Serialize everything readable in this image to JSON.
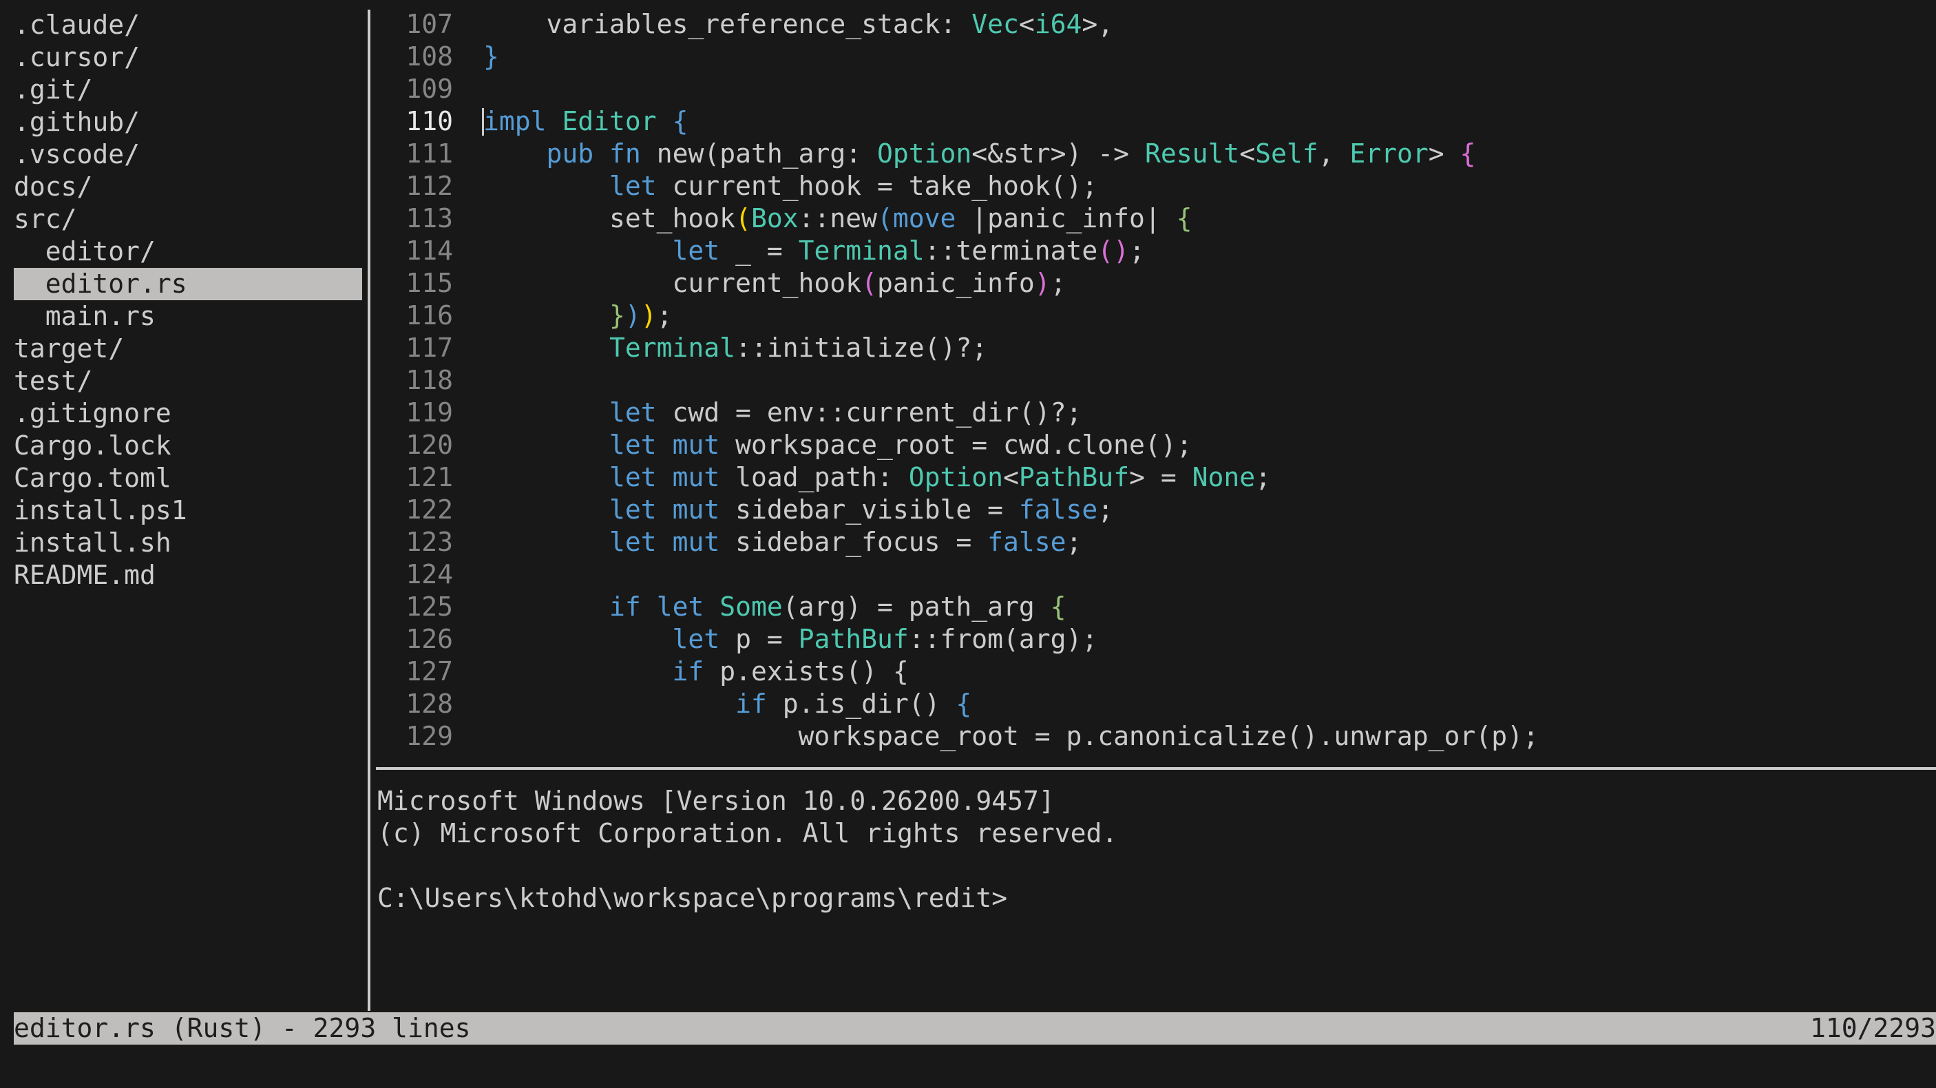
{
  "sidebar": {
    "items": [
      {
        "label": ".claude/",
        "indent": 0
      },
      {
        "label": ".cursor/",
        "indent": 0
      },
      {
        "label": ".git/",
        "indent": 0
      },
      {
        "label": ".github/",
        "indent": 0
      },
      {
        "label": ".vscode/",
        "indent": 0
      },
      {
        "label": "docs/",
        "indent": 0
      },
      {
        "label": "src/",
        "indent": 0
      },
      {
        "label": "editor/",
        "indent": 1
      },
      {
        "label": "editor.rs",
        "indent": 1,
        "selected": true
      },
      {
        "label": "main.rs",
        "indent": 1
      },
      {
        "label": "target/",
        "indent": 0
      },
      {
        "label": "test/",
        "indent": 0
      },
      {
        "label": ".gitignore",
        "indent": 0
      },
      {
        "label": "Cargo.lock",
        "indent": 0
      },
      {
        "label": "Cargo.toml",
        "indent": 0
      },
      {
        "label": "install.ps1",
        "indent": 0
      },
      {
        "label": "install.sh",
        "indent": 0
      },
      {
        "label": "README.md",
        "indent": 0
      }
    ]
  },
  "editor": {
    "current_line": 110,
    "lines": [
      {
        "n": "107",
        "tokens": [
          [
            "pl",
            "    variables_reference_stack: "
          ],
          [
            "ty",
            "Vec"
          ],
          [
            "pl",
            "<"
          ],
          [
            "ty",
            "i64"
          ],
          [
            "pl",
            ">,"
          ]
        ]
      },
      {
        "n": "108",
        "tokens": [
          [
            "b1",
            "}"
          ]
        ]
      },
      {
        "n": "109",
        "tokens": []
      },
      {
        "n": "110",
        "tokens": [
          [
            "kw",
            "impl"
          ],
          [
            "pl",
            " "
          ],
          [
            "ty",
            "Editor"
          ],
          [
            "pl",
            " "
          ],
          [
            "b1",
            "{"
          ]
        ]
      },
      {
        "n": "111",
        "tokens": [
          [
            "pl",
            "    "
          ],
          [
            "kw",
            "pub"
          ],
          [
            "pl",
            " "
          ],
          [
            "kw",
            "fn"
          ],
          [
            "pl",
            " new(path_arg: "
          ],
          [
            "ty",
            "Option"
          ],
          [
            "pl",
            "<&str>) -> "
          ],
          [
            "ty",
            "Result"
          ],
          [
            "pl",
            "<"
          ],
          [
            "ty",
            "Self"
          ],
          [
            "pl",
            ", "
          ],
          [
            "ty",
            "Error"
          ],
          [
            "pl",
            "> "
          ],
          [
            "b2",
            "{"
          ]
        ]
      },
      {
        "n": "112",
        "tokens": [
          [
            "pl",
            "        "
          ],
          [
            "kw",
            "let"
          ],
          [
            "pl",
            " current_hook = take_hook();"
          ]
        ]
      },
      {
        "n": "113",
        "tokens": [
          [
            "pl",
            "        set_hook"
          ],
          [
            "b3",
            "("
          ],
          [
            "ty",
            "Box"
          ],
          [
            "pl",
            "::new"
          ],
          [
            "b1",
            "("
          ],
          [
            "kw",
            "move"
          ],
          [
            "pl",
            " |panic_info| "
          ],
          [
            "bg",
            "{"
          ]
        ]
      },
      {
        "n": "114",
        "tokens": [
          [
            "pl",
            "            "
          ],
          [
            "kw",
            "let"
          ],
          [
            "pl",
            " _ = "
          ],
          [
            "ty",
            "Terminal"
          ],
          [
            "pl",
            "::terminate"
          ],
          [
            "b2",
            "()"
          ],
          [
            "pl",
            ";"
          ]
        ]
      },
      {
        "n": "115",
        "tokens": [
          [
            "pl",
            "            current_hook"
          ],
          [
            "b2",
            "("
          ],
          [
            "pl",
            "panic_info"
          ],
          [
            "b2",
            ")"
          ],
          [
            "pl",
            ";"
          ]
        ]
      },
      {
        "n": "116",
        "tokens": [
          [
            "pl",
            "        "
          ],
          [
            "bg",
            "}"
          ],
          [
            "b1",
            ")"
          ],
          [
            "b3",
            ")"
          ],
          [
            "pl",
            ";"
          ]
        ]
      },
      {
        "n": "117",
        "tokens": [
          [
            "pl",
            "        "
          ],
          [
            "ty",
            "Terminal"
          ],
          [
            "pl",
            "::initialize()?;"
          ]
        ]
      },
      {
        "n": "118",
        "tokens": []
      },
      {
        "n": "119",
        "tokens": [
          [
            "pl",
            "        "
          ],
          [
            "kw",
            "let"
          ],
          [
            "pl",
            " cwd = env::current_dir()?;"
          ]
        ]
      },
      {
        "n": "120",
        "tokens": [
          [
            "pl",
            "        "
          ],
          [
            "kw",
            "let"
          ],
          [
            "pl",
            " "
          ],
          [
            "kw",
            "mut"
          ],
          [
            "pl",
            " workspace_root = cwd.clone();"
          ]
        ]
      },
      {
        "n": "121",
        "tokens": [
          [
            "pl",
            "        "
          ],
          [
            "kw",
            "let"
          ],
          [
            "pl",
            " "
          ],
          [
            "kw",
            "mut"
          ],
          [
            "pl",
            " load_path: "
          ],
          [
            "ty",
            "Option"
          ],
          [
            "pl",
            "<"
          ],
          [
            "ty",
            "PathBuf"
          ],
          [
            "pl",
            "> = "
          ],
          [
            "ty",
            "None"
          ],
          [
            "pl",
            ";"
          ]
        ]
      },
      {
        "n": "122",
        "tokens": [
          [
            "pl",
            "        "
          ],
          [
            "kw",
            "let"
          ],
          [
            "pl",
            " "
          ],
          [
            "kw",
            "mut"
          ],
          [
            "pl",
            " sidebar_visible = "
          ],
          [
            "kw",
            "false"
          ],
          [
            "pl",
            ";"
          ]
        ]
      },
      {
        "n": "123",
        "tokens": [
          [
            "pl",
            "        "
          ],
          [
            "kw",
            "let"
          ],
          [
            "pl",
            " "
          ],
          [
            "kw",
            "mut"
          ],
          [
            "pl",
            " sidebar_focus = "
          ],
          [
            "kw",
            "false"
          ],
          [
            "pl",
            ";"
          ]
        ]
      },
      {
        "n": "124",
        "tokens": []
      },
      {
        "n": "125",
        "tokens": [
          [
            "pl",
            "        "
          ],
          [
            "kw",
            "if"
          ],
          [
            "pl",
            " "
          ],
          [
            "kw",
            "let"
          ],
          [
            "pl",
            " "
          ],
          [
            "ty",
            "Some"
          ],
          [
            "pl",
            "(arg) = path_arg "
          ],
          [
            "bg",
            "{"
          ]
        ]
      },
      {
        "n": "126",
        "tokens": [
          [
            "pl",
            "            "
          ],
          [
            "kw",
            "let"
          ],
          [
            "pl",
            " p = "
          ],
          [
            "ty",
            "PathBuf"
          ],
          [
            "pl",
            "::from(arg);"
          ]
        ]
      },
      {
        "n": "127",
        "tokens": [
          [
            "pl",
            "            "
          ],
          [
            "kw",
            "if"
          ],
          [
            "pl",
            " p.exists() {"
          ]
        ]
      },
      {
        "n": "128",
        "tokens": [
          [
            "pl",
            "                "
          ],
          [
            "kw",
            "if"
          ],
          [
            "pl",
            " p.is_dir() "
          ],
          [
            "b1",
            "{"
          ]
        ]
      },
      {
        "n": "129",
        "tokens": [
          [
            "pl",
            "                    workspace_root = p.canonicalize().unwrap_or(p);"
          ]
        ]
      }
    ]
  },
  "terminal": {
    "lines": [
      "Microsoft Windows [Version 10.0.26200.9457]",
      "(c) Microsoft Corporation. All rights reserved.",
      "",
      "C:\\Users\\ktohd\\workspace\\programs\\redit>"
    ]
  },
  "statusbar": {
    "left": "editor.rs (Rust) - 2293 lines",
    "right": "110/2293"
  },
  "colors": {
    "background": "#181818",
    "text": "#cccccc",
    "keyword": "#569cd6",
    "type": "#4ec9b0",
    "selection_bg": "#c0bdbd",
    "line_number": "#858585"
  }
}
